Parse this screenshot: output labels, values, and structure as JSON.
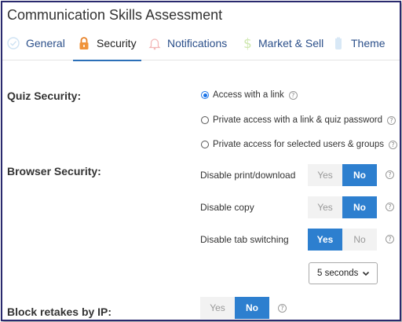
{
  "page": {
    "title": "Communication Skills Assessment"
  },
  "tabs": [
    {
      "label": "General",
      "icon": "checkmark-circle-icon"
    },
    {
      "label": "Security",
      "icon": "lock-icon",
      "active": true
    },
    {
      "label": "Notifications",
      "icon": "bell-icon"
    },
    {
      "label": "Market & Sell",
      "icon": "dollar-icon"
    },
    {
      "label": "Theme",
      "icon": "paint-bucket-icon"
    }
  ],
  "quiz_security": {
    "label": "Quiz Security:",
    "options": [
      {
        "label": "Access with a link",
        "selected": true
      },
      {
        "label": "Private access with a link & quiz password",
        "selected": false
      },
      {
        "label": "Private access for selected users & groups",
        "selected": false
      }
    ]
  },
  "browser_security": {
    "label": "Browser Security:",
    "rows": [
      {
        "label": "Disable print/download",
        "yes": "Yes",
        "no": "No",
        "value": "No"
      },
      {
        "label": "Disable copy",
        "yes": "Yes",
        "no": "No",
        "value": "No"
      },
      {
        "label": "Disable tab switching",
        "yes": "Yes",
        "no": "No",
        "value": "Yes"
      }
    ],
    "tab_switch_delay": "5 seconds"
  },
  "block_retakes": {
    "label": "Block retakes by IP:",
    "yes": "Yes",
    "no": "No",
    "value": "No"
  },
  "help_glyph": "?",
  "colors": {
    "accent": "#2d7fcf",
    "tab_text": "#2b4f8a",
    "frame": "#2a2a6e"
  }
}
